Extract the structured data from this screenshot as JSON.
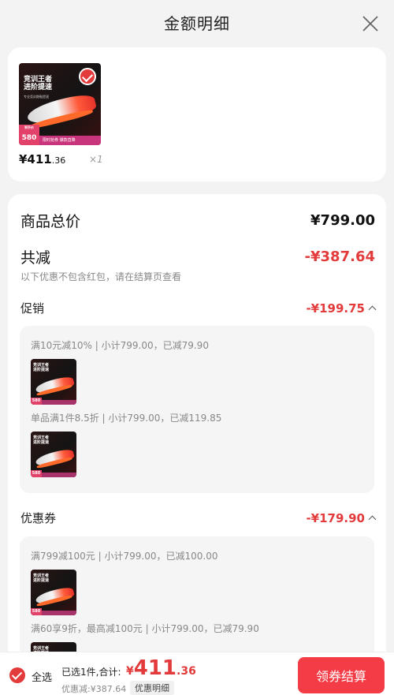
{
  "header": {
    "title": "金额明细"
  },
  "product": {
    "image_text": "竞训王者\n进阶提速",
    "image_subtext": "专业竞训跑鞋提速",
    "image_price_label": "到手价",
    "image_price": "580",
    "image_promo": "限时抢券 爆款直降",
    "price_main": "¥411",
    "price_dec": ".36",
    "qty": "×1"
  },
  "summary": {
    "total_label": "商品总价",
    "total_value": "¥799.00",
    "discount_label": "共减",
    "discount_value": "-¥387.64",
    "note": "以下优惠不包含红包，请在结算页查看"
  },
  "promotion": {
    "label": "促销",
    "amount": "-¥199.75",
    "rules": [
      "满10元减10% | 小计799.00，已减79.90",
      "单品满1件8.5折 | 小计799.00，已减119.85"
    ]
  },
  "coupon": {
    "label": "优惠券",
    "amount": "-¥179.90",
    "rules": [
      "满799减100元 | 小计799.00，已减100.00",
      "满60享9折，最高减100元 | 小计799.00，已减79.90"
    ]
  },
  "bottom": {
    "select_all": "全选",
    "selected_text": "已选1件,合计:",
    "total_cur": "¥",
    "total_main": "411",
    "total_dec": ".36",
    "discount_text": "优惠减:¥387.64",
    "detail_label": "优惠明细",
    "checkout_label": "领券结算"
  },
  "colors": {
    "accent": "#e33b3b",
    "checkout": "#f33c46"
  },
  "icons": {
    "close": "close-icon",
    "check": "check-icon",
    "caret": "chevron-up-icon"
  }
}
